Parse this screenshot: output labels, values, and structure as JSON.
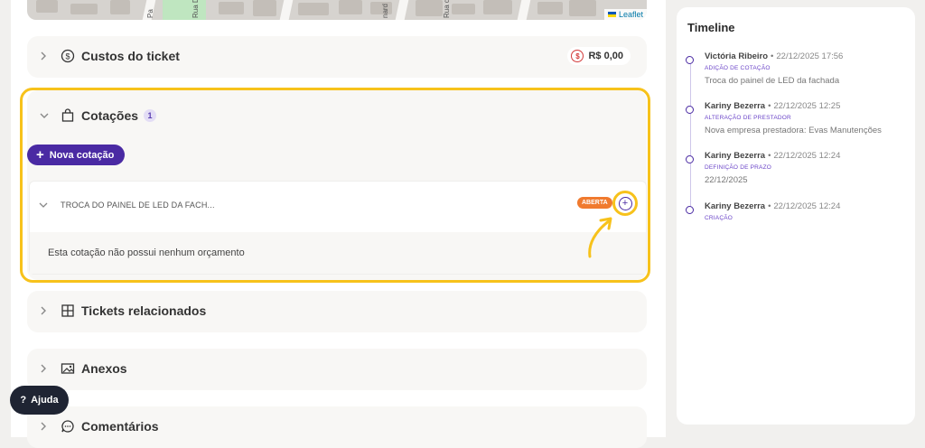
{
  "map": {
    "attribution": "Leaflet",
    "street_labels": [
      "Pa",
      "Rua Div",
      "nard",
      "Rua d"
    ]
  },
  "sections": {
    "custos": {
      "title": "Custos do ticket",
      "amount": "R$ 0,00"
    },
    "cotacoes": {
      "title": "Cotações",
      "count": "1",
      "new_button": "Nova cotação",
      "quote": {
        "title": "TROCA DO PAINEL DE LED DA FACH...",
        "status": "ABERTA",
        "empty_text": "Esta cotação não possui nenhum orçamento"
      }
    },
    "tickets": {
      "title": "Tickets relacionados"
    },
    "anexos": {
      "title": "Anexos"
    },
    "comentarios": {
      "title": "Comentários"
    }
  },
  "help": {
    "label": "Ajuda"
  },
  "timeline": {
    "title": "Timeline",
    "entries": [
      {
        "name": "Victória Ribeiro",
        "sep": "•",
        "date": "22/12/2025 17:56",
        "type": "ADIÇÃO DE COTAÇÃO",
        "desc": "Troca do painel de LED da fachada"
      },
      {
        "name": "Kariny Bezerra",
        "sep": "•",
        "date": "22/12/2025 12:25",
        "type": "ALTERAÇÃO DE PRESTADOR",
        "desc": "Nova empresa prestadora: Evas Manutenções"
      },
      {
        "name": "Kariny Bezerra",
        "sep": "•",
        "date": "22/12/2025 12:24",
        "type": "DEFINIÇÃO DE PRAZO",
        "desc": "22/12/2025"
      },
      {
        "name": "Kariny Bezerra",
        "sep": "•",
        "date": "22/12/2025 12:24",
        "type": "CRIAÇÃO",
        "desc": ""
      }
    ]
  },
  "colors": {
    "accent": "#4a2aa3",
    "highlight": "#f7c21b",
    "status_open": "#f07a2e"
  }
}
